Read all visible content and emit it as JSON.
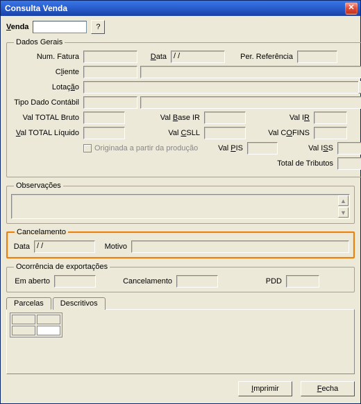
{
  "window": {
    "title": "Consulta Venda"
  },
  "top": {
    "venda_label": "Venda",
    "venda_value": "",
    "help_label": "?"
  },
  "dados_gerais": {
    "legend": "Dados Gerais",
    "num_fatura_label": "Num. Fatura",
    "num_fatura_value": "",
    "data_label": "Data",
    "data_value": "  /  /",
    "per_ref_label": "Per. Referência",
    "per_ref_value": "",
    "cliente_label": "Cliente",
    "cliente_code": "",
    "cliente_name": "",
    "lotacao_label": "Lotação",
    "lotacao_value": "",
    "tipo_dado_label": "Tipo Dado Contábil",
    "tipo_dado_code": "",
    "tipo_dado_name": "",
    "val_total_bruto_label": "Val TOTAL Bruto",
    "val_total_bruto_value": "",
    "val_base_ir_label": "Val Base IR",
    "val_base_ir_value": "",
    "val_ir_label": "Val IR",
    "val_ir_value": "",
    "val_total_liquido_label": "Val TOTAL Líquido",
    "val_total_liquido_value": "",
    "val_csll_label": "Val CSLL",
    "val_csll_value": "",
    "val_cofins_label": "Val COFINS",
    "val_cofins_value": "",
    "originada_label": "Originada a partir da produção",
    "val_pis_label": "Val PIS",
    "val_pis_value": "",
    "val_iss_label": "Val ISS",
    "val_iss_value": "",
    "total_tributos_label": "Total de Tributos",
    "total_tributos_value": ""
  },
  "observacoes": {
    "legend": "Observações"
  },
  "cancelamento": {
    "legend": "Cancelamento",
    "data_label": "Data",
    "data_value": "  /  /",
    "motivo_label": "Motivo",
    "motivo_value": ""
  },
  "ocorrencia": {
    "legend": "Ocorrência de exportações",
    "em_aberto_label": "Em  aberto",
    "em_aberto_value": "",
    "cancel_label": "Cancelamento",
    "cancel_value": "",
    "pdd_label": "PDD",
    "pdd_value": ""
  },
  "tabs": {
    "parcelas": "Parcelas",
    "descritivos": "Descritivos"
  },
  "footer": {
    "imprimir": "Imprimir",
    "fechar": "Fecha"
  }
}
